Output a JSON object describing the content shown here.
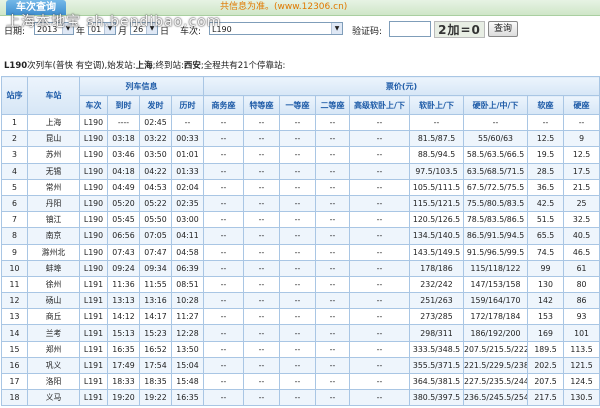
{
  "header": {
    "tab_label": "车次查询",
    "hotline": "共信息为准。(www.12306.cn)",
    "watermark": "上海本地宝 sh.bendibao.com"
  },
  "form": {
    "date_label": "日期:",
    "year": "2013",
    "year_suffix": "年",
    "month": "01",
    "month_suffix": "月",
    "day": "26",
    "day_suffix": "日",
    "train_label": "车次:",
    "train_value": "L190",
    "captcha_label": "验证码:",
    "captcha_value": "",
    "captcha_image_text": "2加=0",
    "query_button": "查询"
  },
  "summary": {
    "train": "L190",
    "text1": "次列车(普快 有空调),始发站:",
    "start": "上海",
    "text2": ";终到站:",
    "end": "西安",
    "text3": ";全程共有21个停靠站:"
  },
  "table": {
    "group_headers": {
      "num": "站序",
      "station": "车站",
      "train_info": "列车信息",
      "fares": "票价(元)"
    },
    "columns": [
      "车次",
      "到时",
      "发时",
      "历时",
      "商务座",
      "特等座",
      "一等座",
      "二等座",
      "高级软卧上/下",
      "软卧上/下",
      "硬卧上/中/下",
      "软座",
      "硬座"
    ],
    "rows": [
      [
        "1",
        "上海",
        "L190",
        "----",
        "02:45",
        "--",
        "--",
        "--",
        "--",
        "--",
        "--",
        "--",
        "--",
        "--",
        "--"
      ],
      [
        "2",
        "昆山",
        "L190",
        "03:18",
        "03:22",
        "00:33",
        "--",
        "--",
        "--",
        "--",
        "--",
        "81.5/87.5",
        "55/60/63",
        "12.5",
        "9"
      ],
      [
        "3",
        "苏州",
        "L190",
        "03:46",
        "03:50",
        "01:01",
        "--",
        "--",
        "--",
        "--",
        "--",
        "88.5/94.5",
        "58.5/63.5/66.5",
        "19.5",
        "12.5"
      ],
      [
        "4",
        "无锡",
        "L190",
        "04:18",
        "04:22",
        "01:33",
        "--",
        "--",
        "--",
        "--",
        "--",
        "97.5/103.5",
        "63.5/68.5/71.5",
        "28.5",
        "17.5"
      ],
      [
        "5",
        "常州",
        "L190",
        "04:49",
        "04:53",
        "02:04",
        "--",
        "--",
        "--",
        "--",
        "--",
        "105.5/111.5",
        "67.5/72.5/75.5",
        "36.5",
        "21.5"
      ],
      [
        "6",
        "丹阳",
        "L190",
        "05:20",
        "05:22",
        "02:35",
        "--",
        "--",
        "--",
        "--",
        "--",
        "115.5/121.5",
        "75.5/80.5/83.5",
        "42.5",
        "25"
      ],
      [
        "7",
        "镇江",
        "L190",
        "05:45",
        "05:50",
        "03:00",
        "--",
        "--",
        "--",
        "--",
        "--",
        "120.5/126.5",
        "78.5/83.5/86.5",
        "51.5",
        "32.5"
      ],
      [
        "8",
        "南京",
        "L190",
        "06:56",
        "07:05",
        "04:11",
        "--",
        "--",
        "--",
        "--",
        "--",
        "134.5/140.5",
        "86.5/91.5/94.5",
        "65.5",
        "40.5"
      ],
      [
        "9",
        "滁州北",
        "L190",
        "07:43",
        "07:47",
        "04:58",
        "--",
        "--",
        "--",
        "--",
        "--",
        "143.5/149.5",
        "91.5/96.5/99.5",
        "74.5",
        "46.5"
      ],
      [
        "10",
        "蚌埠",
        "L190",
        "09:24",
        "09:34",
        "06:39",
        "--",
        "--",
        "--",
        "--",
        "--",
        "178/186",
        "115/118/122",
        "99",
        "61"
      ],
      [
        "11",
        "徐州",
        "L191",
        "11:36",
        "11:55",
        "08:51",
        "--",
        "--",
        "--",
        "--",
        "--",
        "232/242",
        "147/153/158",
        "130",
        "80"
      ],
      [
        "12",
        "砀山",
        "L191",
        "13:13",
        "13:16",
        "10:28",
        "--",
        "--",
        "--",
        "--",
        "--",
        "251/263",
        "159/164/170",
        "142",
        "86"
      ],
      [
        "13",
        "商丘",
        "L191",
        "14:12",
        "14:17",
        "11:27",
        "--",
        "--",
        "--",
        "--",
        "--",
        "273/285",
        "172/178/184",
        "153",
        "93"
      ],
      [
        "14",
        "兰考",
        "L191",
        "15:13",
        "15:23",
        "12:28",
        "--",
        "--",
        "--",
        "--",
        "--",
        "298/311",
        "186/192/200",
        "169",
        "101"
      ],
      [
        "15",
        "郑州",
        "L191",
        "16:35",
        "16:52",
        "13:50",
        "--",
        "--",
        "--",
        "--",
        "--",
        "333.5/348.5",
        "207.5/215.5/222.5",
        "189.5",
        "113.5"
      ],
      [
        "16",
        "巩义",
        "L191",
        "17:49",
        "17:54",
        "15:04",
        "--",
        "--",
        "--",
        "--",
        "--",
        "355.5/371.5",
        "221.5/229.5/238.5",
        "202.5",
        "121.5"
      ],
      [
        "17",
        "洛阳",
        "L191",
        "18:33",
        "18:35",
        "15:48",
        "--",
        "--",
        "--",
        "--",
        "--",
        "364.5/381.5",
        "227.5/235.5/244.5",
        "207.5",
        "124.5"
      ],
      [
        "18",
        "义马",
        "L191",
        "19:20",
        "19:22",
        "16:35",
        "--",
        "--",
        "--",
        "--",
        "--",
        "380.5/397.5",
        "236.5/245.5/254.5",
        "217.5",
        "130.5"
      ]
    ]
  }
}
